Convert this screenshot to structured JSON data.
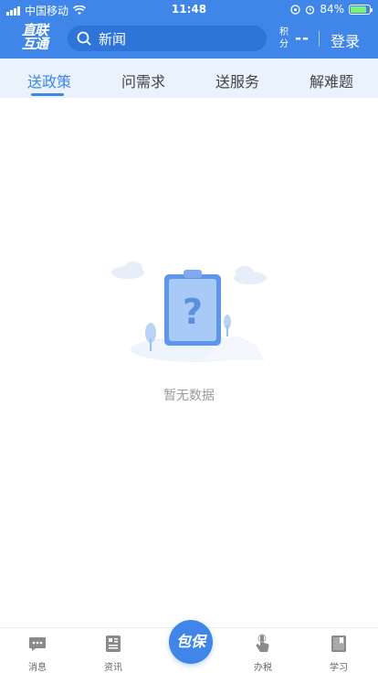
{
  "status_bar": {
    "carrier": "中国移动",
    "time": "11:48",
    "battery": "84%",
    "battery_level": 0.84
  },
  "app_bar": {
    "logo_line1": "直联",
    "logo_line2": "互通",
    "search_text": "新闻",
    "points_label_1": "积",
    "points_label_2": "分",
    "points_value": "--",
    "login_label": "登录"
  },
  "tabs": [
    {
      "label": "送政策",
      "active": true
    },
    {
      "label": "问需求",
      "active": false
    },
    {
      "label": "送服务",
      "active": false
    },
    {
      "label": "解难题",
      "active": false
    }
  ],
  "empty_state": {
    "message": "暂无数据"
  },
  "bottom_nav": {
    "items": [
      {
        "label": "消息",
        "icon": "message-icon"
      },
      {
        "label": "资讯",
        "icon": "news-icon"
      },
      {
        "label": "办税",
        "icon": "tax-icon"
      },
      {
        "label": "学习",
        "icon": "study-icon"
      }
    ],
    "center_label": "包保"
  },
  "colors": {
    "primary": "#3f86e8",
    "tab_bg": "#eaf2fd",
    "muted_text": "#9a9a9a"
  }
}
